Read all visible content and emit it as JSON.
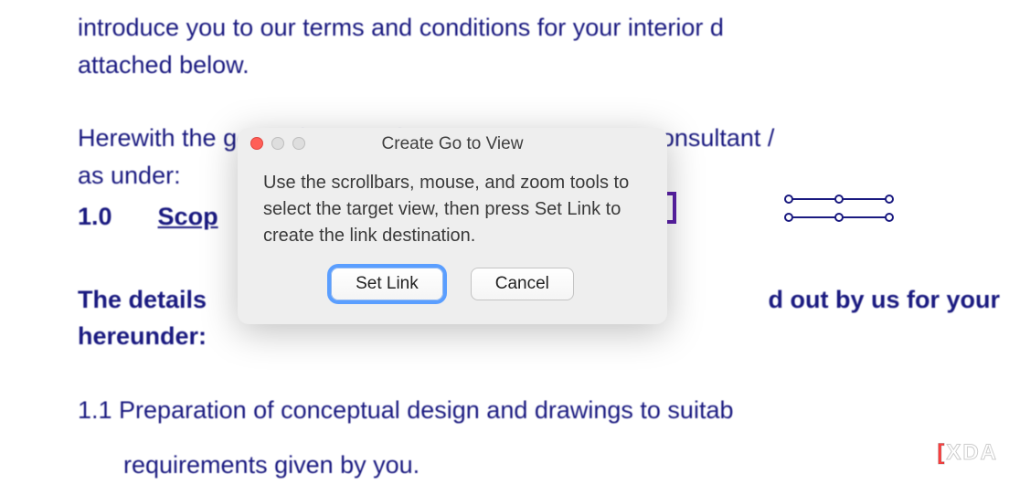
{
  "document": {
    "line_intro": "introduce you to our terms and conditions for your interior d",
    "line_attached": "attached below.",
    "line_herewith": "Herewith the general terms of our engagement as a consultant /",
    "line_asunder": "as under:",
    "scope_num": "1.0",
    "scope_label": "Scop",
    "line_details": "The details",
    "line_details_right": "d out by us for your",
    "line_hereunder": "hereunder:",
    "line_prep": "1.1 Preparation of conceptual design and drawings to suitab",
    "line_req": "requirements given by you."
  },
  "dialog": {
    "title": "Create Go to View",
    "message": "Use the scrollbars, mouse, and zoom tools to select the target view, then press Set Link to create the link destination.",
    "set_link_label": "Set Link",
    "cancel_label": "Cancel"
  },
  "watermark": {
    "prefix": "[",
    "x": "X",
    "rest": "DA"
  }
}
